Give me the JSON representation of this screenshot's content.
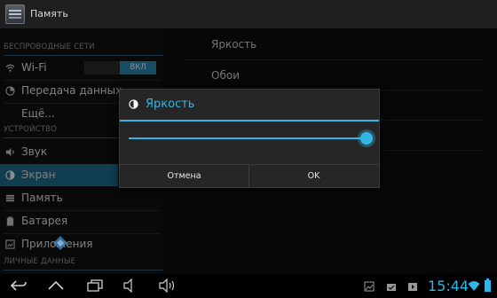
{
  "app": {
    "title": "Память"
  },
  "sidebar": {
    "sections": [
      {
        "header": "БЕСПРОВОДНЫЕ СЕТИ"
      },
      {
        "header": "УСТРОЙСТВО"
      },
      {
        "header": "ЛИЧНЫЕ ДАННЫЕ"
      }
    ],
    "items": [
      {
        "label": "Wi-Fi",
        "icon": "wifi-icon",
        "toggle_label": "ВКЛ"
      },
      {
        "label": "Передача данных",
        "icon": "data-usage-icon"
      },
      {
        "label": "Ещё..."
      },
      {
        "label": "Звук",
        "icon": "sound-icon"
      },
      {
        "label": "Экран",
        "icon": "display-icon",
        "selected": true
      },
      {
        "label": "Память",
        "icon": "storage-icon"
      },
      {
        "label": "Батарея",
        "icon": "battery-icon"
      },
      {
        "label": "Приложения",
        "icon": "apps-icon"
      }
    ]
  },
  "content": {
    "items": [
      {
        "label": "Яркость"
      },
      {
        "label": "Обои"
      }
    ]
  },
  "dialog": {
    "title": "Яркость",
    "brightness_fraction": 1.0,
    "cancel_label": "Отмена",
    "ok_label": "OK"
  },
  "statusbar": {
    "time": "15:44"
  },
  "colors": {
    "accent": "#33b5e5",
    "selected_bg": "#1f6f93",
    "toggle_on": "#2e8cb8"
  }
}
